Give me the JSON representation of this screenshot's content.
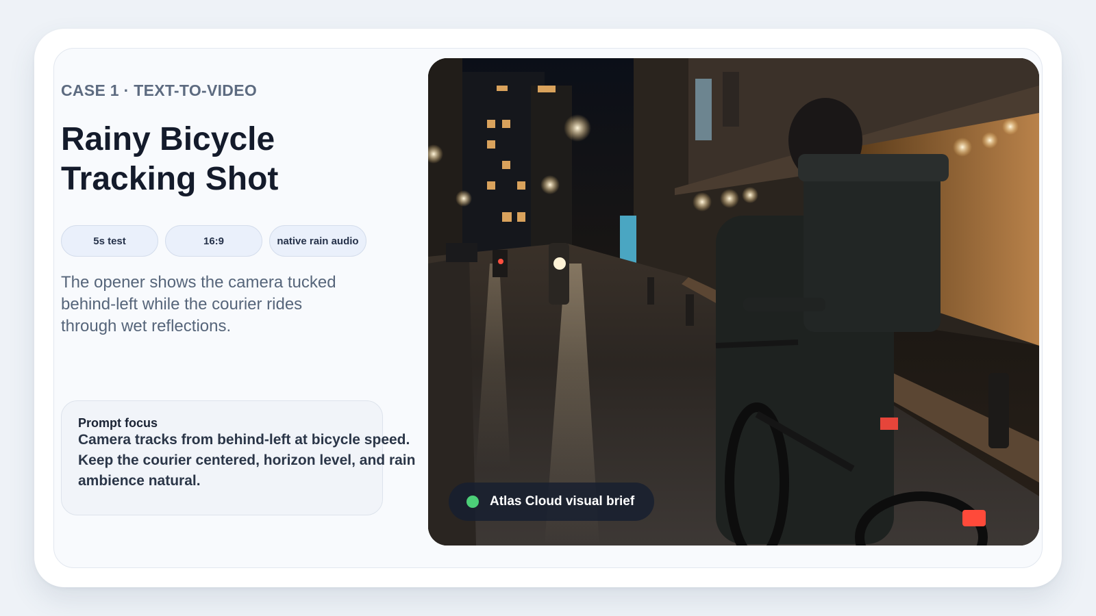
{
  "case_label": "CASE 1 · TEXT-TO-VIDEO",
  "title_line1": "Rainy Bicycle",
  "title_line2": "Tracking Shot",
  "chips": [
    "5s test",
    "16:9",
    "native rain audio"
  ],
  "description": "The opener shows the camera tucked behind-left while the courier rides through wet reflections.",
  "prompt_focus": {
    "label": "Prompt focus",
    "text": "Camera tracks from behind-left at bicycle speed. Keep the courier centered, horizon level, and rain ambience natural."
  },
  "preview": {
    "badge_text": "Atlas Cloud visual brief",
    "status_color": "#4ccf78",
    "scene": "night rainy street with courier on bicycle"
  }
}
